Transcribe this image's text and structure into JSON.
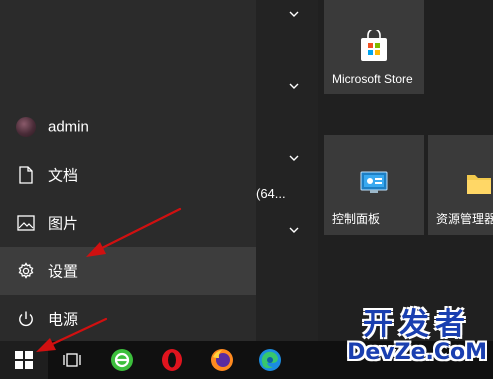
{
  "nav": {
    "user": "admin",
    "documents": "文档",
    "pictures": "图片",
    "settings": "设置",
    "power": "电源"
  },
  "app_list": {
    "truncated_text": "(64..."
  },
  "tiles": {
    "store": "Microsoft Store",
    "control_panel": "控制面板",
    "explorer": "资源管理器"
  },
  "watermark": {
    "top": "开发者",
    "bottom": "DevZe.CoM"
  },
  "colors": {
    "nav_bg": "#2b2b2b",
    "active_item_bg": "#3d3d3d",
    "tile_bg": "#3a3a3a",
    "taskbar_bg": "#101010",
    "arrow": "#d01010",
    "watermark": "#1a3fb0"
  },
  "icons": {
    "documents": "document-icon",
    "pictures": "picture-icon",
    "settings": "gear-icon",
    "power": "power-icon",
    "start": "windows-logo-icon",
    "task_view": "task-view-icon"
  }
}
